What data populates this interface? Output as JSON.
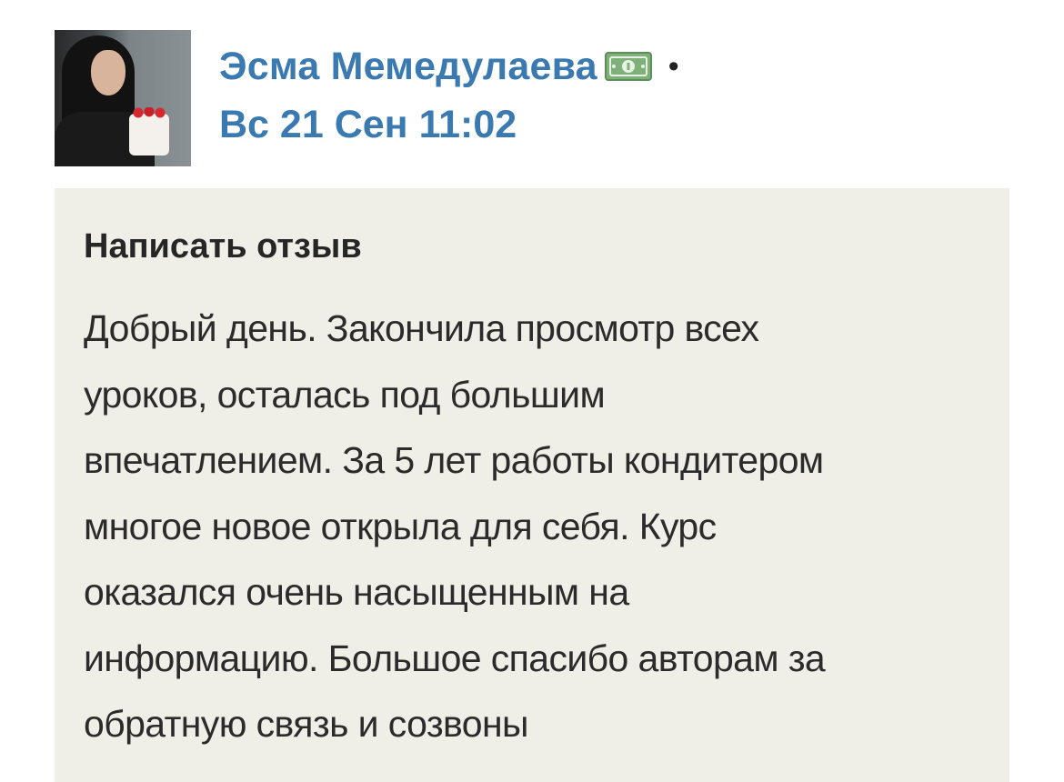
{
  "post": {
    "author_name": "Эсма Мемедулаева",
    "author_badge_icon": "money-bill-icon",
    "separator": "•",
    "date": "Вс 21 Сен 11:02"
  },
  "review": {
    "title": "Написать отзыв",
    "lines": [
      "Добрый день. Закончила просмотр всех",
      "уроков, осталась под большим",
      "впечатлением. За 5 лет работы кондитером",
      "многое новое открыла для себя. Курс",
      "оказался очень насыщенным на",
      "информацию. Большое спасибо авторам за",
      "обратную связь и созвоны"
    ]
  },
  "colors": {
    "link_blue": "#3a7ab1",
    "review_bg": "#efeee7",
    "text_dark": "#2b2b2b",
    "badge_green": "#7fb07a"
  }
}
